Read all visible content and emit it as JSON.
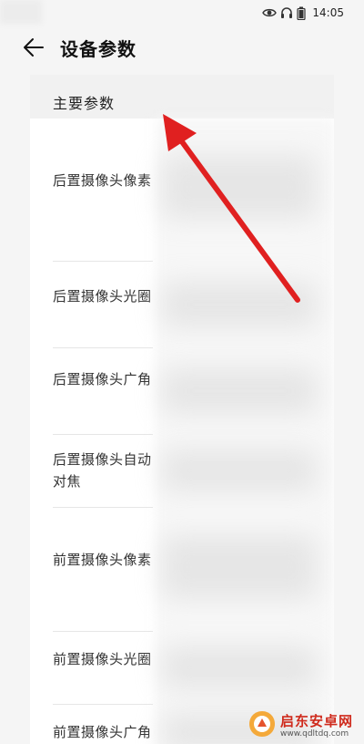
{
  "status_bar": {
    "time": "14:05",
    "icons": [
      "eye-icon",
      "headphone-icon",
      "battery-icon"
    ]
  },
  "header": {
    "back_icon": "arrow-left-icon",
    "title": "设备参数"
  },
  "section": {
    "title": "主要参数"
  },
  "rows": [
    {
      "label": "后置摄像头像素"
    },
    {
      "label": "后置摄像头光圈"
    },
    {
      "label": "后置摄像头广角"
    },
    {
      "label": "后置摄像头自动对焦"
    },
    {
      "label": "前置摄像头像素"
    },
    {
      "label": "前置摄像头光圈"
    },
    {
      "label": "前置摄像头广角"
    }
  ],
  "watermark": {
    "name": "启东安卓网",
    "url": "www.qdltdq.com"
  },
  "colors": {
    "arrow": "#e02020",
    "background": "#f5f5f5",
    "card": "#ffffff",
    "section_header_bg": "#f1f1f1",
    "watermark_brand": "#cf2a1c"
  }
}
